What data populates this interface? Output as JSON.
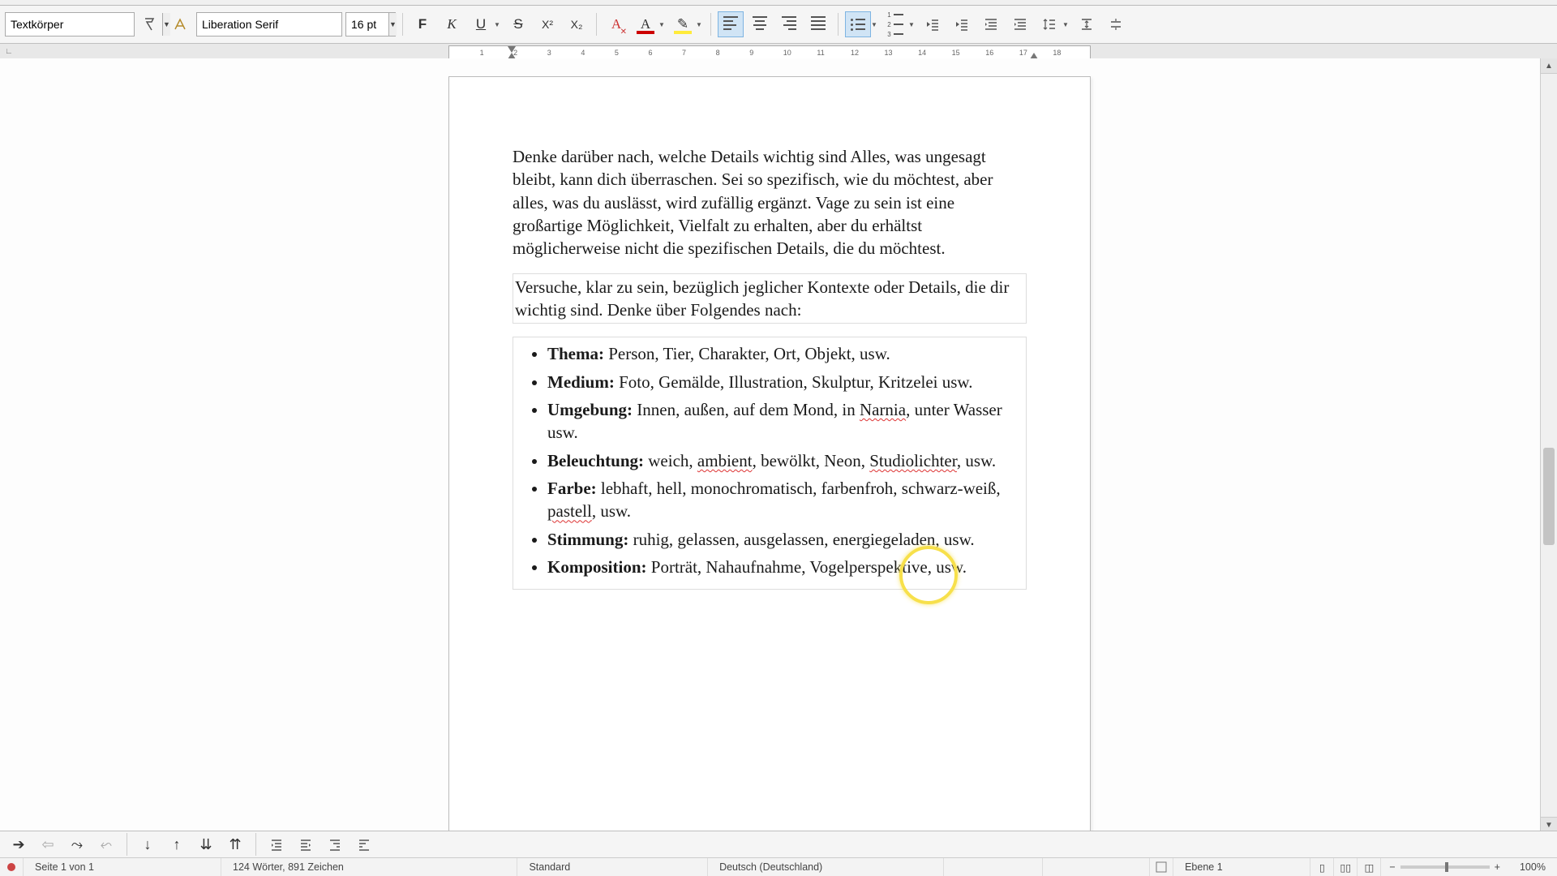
{
  "toolbar": {
    "paragraph_style": "Textkörper",
    "font_name": "Liberation Serif",
    "font_size": "16 pt",
    "bold": "F",
    "italic": "K",
    "underline": "U",
    "strike": "S",
    "superscript": "X²",
    "subscript": "X₂",
    "clearfmt": "A",
    "font_color_glyph": "A",
    "highlight_glyph": "✎"
  },
  "ruler": {
    "labels": [
      "1",
      "2",
      "3",
      "4",
      "5",
      "6",
      "7",
      "8",
      "9",
      "10",
      "11",
      "12",
      "13",
      "14",
      "15",
      "16",
      "17",
      "18"
    ]
  },
  "document": {
    "para1": "Denke darüber nach, welche Details wichtig sind Alles, was ungesagt bleibt, kann dich überraschen. Sei so spezifisch, wie du möchtest, aber alles, was du auslässt, wird zufällig ergänzt. Vage zu sein ist eine großartige Möglichkeit, Vielfalt zu erhalten, aber du erhältst möglicherweise nicht die spezifischen Details, die du möchtest.",
    "para2": "Versuche, klar zu sein, bezüglich jeglicher Kontexte oder Details, die dir wichtig sind. Denke über Folgendes nach:",
    "items": [
      {
        "label": "Thema:",
        "rest_pre": " Person, Tier, Charakter, Ort, Objekt, usw."
      },
      {
        "label": "Medium:",
        "rest_pre": " Foto, Gemälde, Illustration, Skulptur, Kritzelei usw."
      },
      {
        "label": "Umgebung:",
        "rest_pre": " Innen, außen, auf dem Mond, in ",
        "err1": "Narnia",
        "rest_post": ", unter Wasser usw."
      },
      {
        "label": "Beleuchtung:",
        "rest_pre": " weich, ",
        "err1": "ambient",
        "mid1": ", bewölkt, Neon, ",
        "err2": "Studiolichter",
        "rest_post": ", usw."
      },
      {
        "label": "Farbe:",
        "rest_pre": " lebhaft, hell, monochromatisch, farbenfroh, schwarz-weiß, ",
        "err1": "pastell",
        "rest_post": ", usw."
      },
      {
        "label": "Stimmung:",
        "rest_pre": " ruhig, gelassen, ausgelassen, energiegeladen, usw."
      },
      {
        "label": "Komposition:",
        "rest_pre": " Porträt, Nahaufnahme, Vogelperspektive, usw."
      }
    ]
  },
  "status": {
    "page": "Seite 1 von 1",
    "words": "124 Wörter, 891 Zeichen",
    "style": "Standard",
    "lang": "Deutsch (Deutschland)",
    "insert": "Ebene 1",
    "zoom": "100%"
  }
}
